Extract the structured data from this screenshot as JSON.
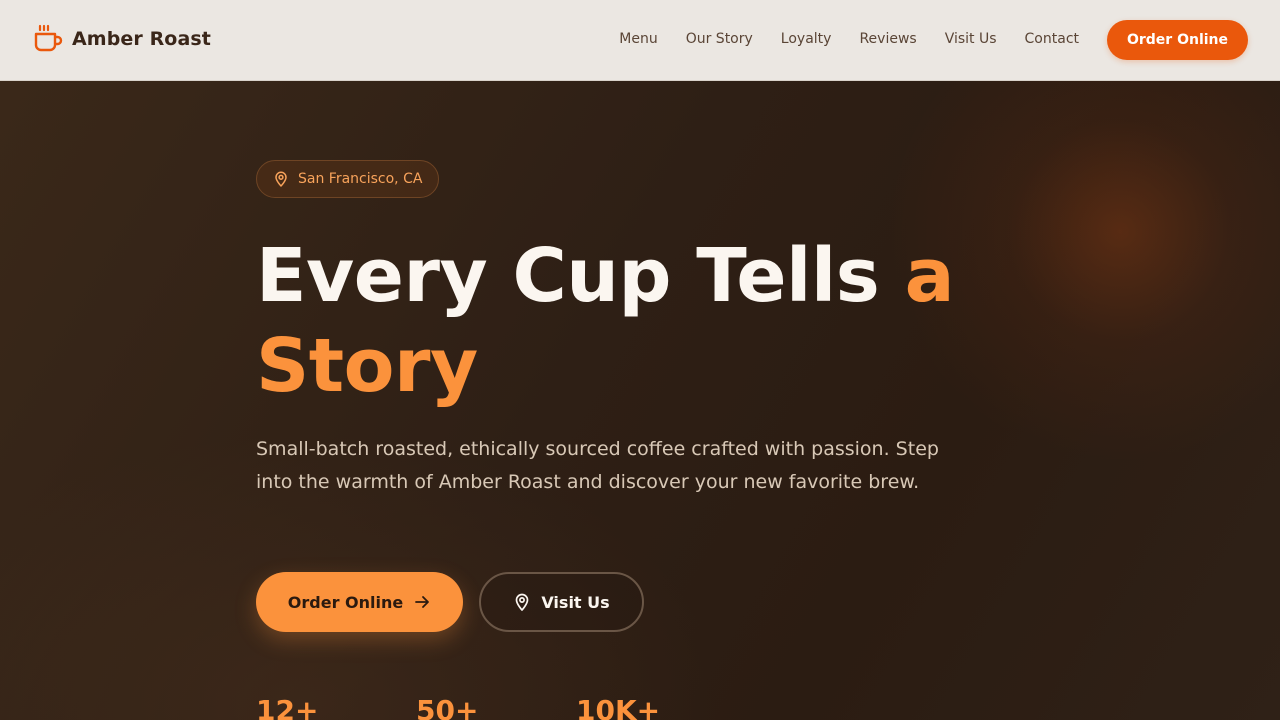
{
  "brand": {
    "name": "Amber Roast",
    "icon": "coffee-cup-icon"
  },
  "nav": {
    "items": [
      {
        "label": "Menu"
      },
      {
        "label": "Our Story"
      },
      {
        "label": "Loyalty"
      },
      {
        "label": "Reviews"
      },
      {
        "label": "Visit Us"
      },
      {
        "label": "Contact"
      }
    ],
    "cta_label": "Order Online"
  },
  "hero": {
    "location": "San Francisco, CA",
    "headline_main": "Every Cup Tells ",
    "headline_accent": "a Story",
    "subtext": "Small-batch roasted, ethically sourced coffee crafted with passion. Step into the warmth of Amber Roast and discover your new favorite brew.",
    "primary_button": "Order Online",
    "secondary_button": "Visit Us",
    "stats": [
      {
        "value": "12+"
      },
      {
        "value": "50+"
      },
      {
        "value": "10K+"
      }
    ]
  },
  "colors": {
    "accent": "#ea580c",
    "accent_light": "#fb923c",
    "header_bg": "#ebe7e2",
    "hero_bg": "#2f2016"
  }
}
